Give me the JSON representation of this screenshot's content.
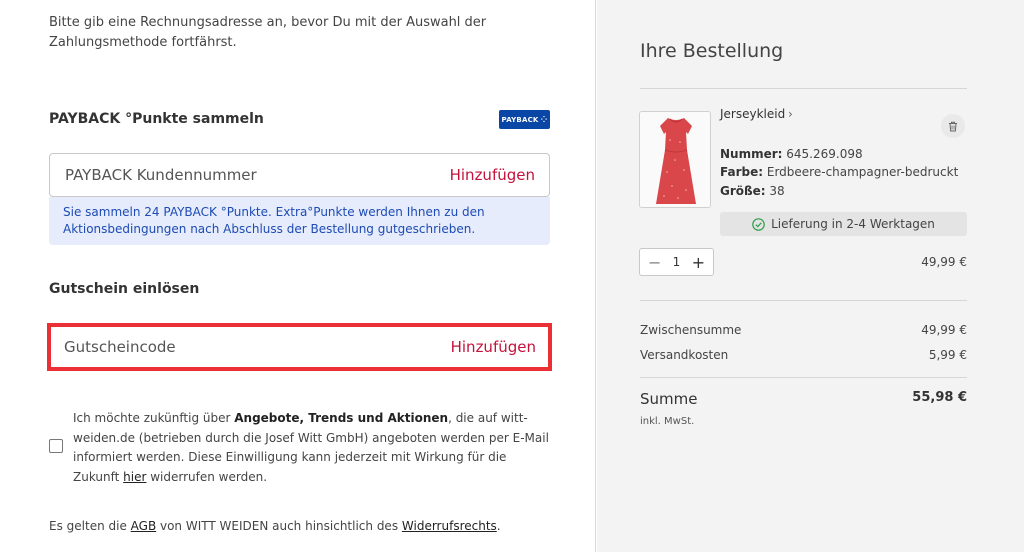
{
  "left": {
    "intro_text": "Bitte gib eine Rechnungsadresse an, bevor Du mit der Auswahl der Zahlungsmethode fortfährst.",
    "payback": {
      "title": "PAYBACK °Punkte sammeln",
      "logo_text": "PAYBACK",
      "input_placeholder": "PAYBACK Kundennummer",
      "add_label": "Hinzufügen",
      "info_text": "Sie sammeln 24 PAYBACK °Punkte. Extra°Punkte werden Ihnen zu den Aktionsbedingungen nach Abschluss der Bestellung gutgeschrieben."
    },
    "voucher": {
      "title": "Gutschein einlösen",
      "input_placeholder": "Gutscheincode",
      "add_label": "Hinzufügen"
    },
    "consent": {
      "part1": "Ich möchte zukünftig über ",
      "bold": "Angebote, Trends und Aktionen",
      "part2": ", die auf witt-weiden.de (betrieben durch die Josef Witt GmbH) angeboten werden per E-Mail informiert werden. Diese Einwilligung kann jederzeit mit Wirkung für die Zukunft ",
      "link": "hier",
      "part3": " widerrufen werden."
    },
    "terms": {
      "part1": "Es gelten die ",
      "agb": "AGB",
      "part2": " von WITT WEIDEN auch hinsichtlich des ",
      "widerruf": "Widerrufsrechts",
      "part3": "."
    }
  },
  "order": {
    "title": "Ihre Bestellung",
    "product": {
      "name": "Jerseykleid",
      "number_label": "Nummer:",
      "number": "645.269.098",
      "color_label": "Farbe:",
      "color": "Erdbeere-champagner-bedruckt",
      "size_label": "Größe:",
      "size": "38",
      "delivery": "Lieferung in 2-4 Werktagen",
      "quantity": "1",
      "price": "49,99 €"
    },
    "subtotal_label": "Zwischensumme",
    "subtotal": "49,99 €",
    "shipping_label": "Versandkosten",
    "shipping": "5,99 €",
    "total_label": "Summe",
    "total": "55,98 €",
    "vat_note": "inkl. MwSt."
  },
  "colors": {
    "accent_red": "#c4123b",
    "highlight_outline": "#ea2f35",
    "info_bg": "#e6ecfb",
    "info_text": "#1c4bb4",
    "payback_blue": "#0a46a5"
  }
}
